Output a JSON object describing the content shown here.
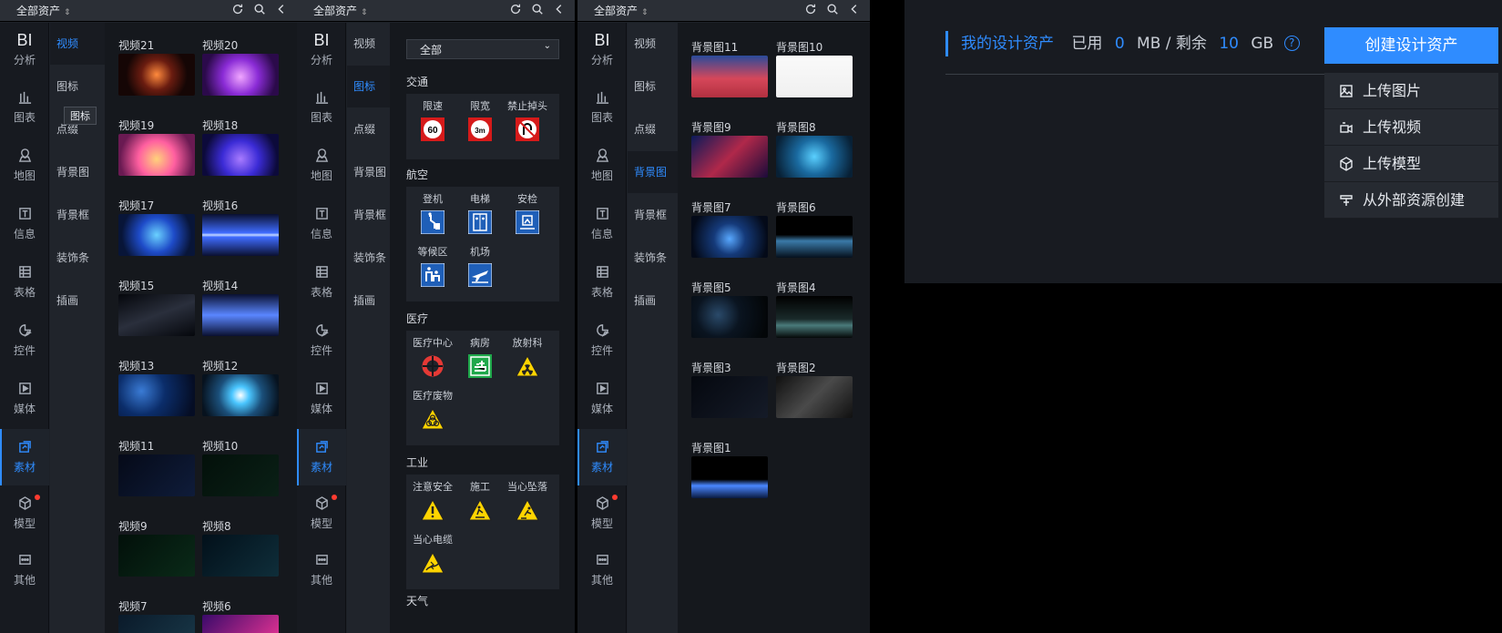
{
  "header": {
    "title": "全部资产"
  },
  "rail": {
    "items": [
      {
        "label": "分析",
        "icon": "bi-text",
        "glyph": "BI"
      },
      {
        "label": "图表",
        "icon": "bar-chart-icon"
      },
      {
        "label": "地图",
        "icon": "map-pin-icon"
      },
      {
        "label": "信息",
        "icon": "text-icon"
      },
      {
        "label": "表格",
        "icon": "table-icon"
      },
      {
        "label": "控件",
        "icon": "widget-icon"
      },
      {
        "label": "媒体",
        "icon": "play-icon"
      },
      {
        "label": "素材",
        "icon": "asset-icon"
      },
      {
        "label": "模型",
        "icon": "cube-icon"
      },
      {
        "label": "其他",
        "icon": "more-icon"
      }
    ]
  },
  "subnav": {
    "items": [
      "视频",
      "图标",
      "点缀",
      "背景图",
      "背景框",
      "装饰条",
      "插画"
    ]
  },
  "panel1": {
    "tooltip": "图标",
    "videos": [
      "视频21",
      "视频20",
      "视频19",
      "视频18",
      "视频17",
      "视频16",
      "视频15",
      "视频14",
      "视频13",
      "视频12",
      "视频11",
      "视频10",
      "视频9",
      "视频8",
      "视频7",
      "视频6"
    ]
  },
  "panel2": {
    "filter": "全部",
    "sections": [
      {
        "title": "交通",
        "items": [
          {
            "label": "限速",
            "sign": "60"
          },
          {
            "label": "限宽",
            "sign": "3m"
          },
          {
            "label": "禁止掉头",
            "sign": "no-u-turn"
          }
        ]
      },
      {
        "title": "航空",
        "items": [
          {
            "label": "登机",
            "sign": "boarding"
          },
          {
            "label": "电梯",
            "sign": "elevator"
          },
          {
            "label": "安检",
            "sign": "security"
          },
          {
            "label": "等候区",
            "sign": "waiting"
          },
          {
            "label": "机场",
            "sign": "airport"
          }
        ]
      },
      {
        "title": "医疗",
        "items": [
          {
            "label": "医疗中心",
            "sign": "medical"
          },
          {
            "label": "病房",
            "sign": "ward"
          },
          {
            "label": "放射科",
            "sign": "radiation"
          },
          {
            "label": "医疗废物",
            "sign": "biohazard"
          }
        ]
      },
      {
        "title": "工业",
        "items": [
          {
            "label": "注意安全",
            "sign": "warning"
          },
          {
            "label": "施工",
            "sign": "construction"
          },
          {
            "label": "当心坠落",
            "sign": "fall"
          },
          {
            "label": "当心电缆",
            "sign": "cable"
          }
        ]
      },
      {
        "title": "天气",
        "items": []
      }
    ]
  },
  "panel3": {
    "backgrounds": [
      "背景图11",
      "背景图10",
      "背景图9",
      "背景图8",
      "背景图7",
      "背景图6",
      "背景图5",
      "背景图4",
      "背景图3",
      "背景图2",
      "背景图1"
    ]
  },
  "assets": {
    "title": "我的设计资产",
    "used_label": "已用",
    "used_value": "0",
    "used_unit": "MB / 剩余",
    "remain_value": "10",
    "remain_unit": "GB",
    "help": "?",
    "create_button": "创建设计资产",
    "menu": [
      {
        "label": "上传图片",
        "icon": "image-icon"
      },
      {
        "label": "上传视频",
        "icon": "video-icon"
      },
      {
        "label": "上传模型",
        "icon": "model-icon"
      },
      {
        "label": "从外部资源创建",
        "icon": "external-icon"
      }
    ]
  },
  "colors": {
    "accent": "#2f8cff",
    "badge": "#ff3b30"
  }
}
